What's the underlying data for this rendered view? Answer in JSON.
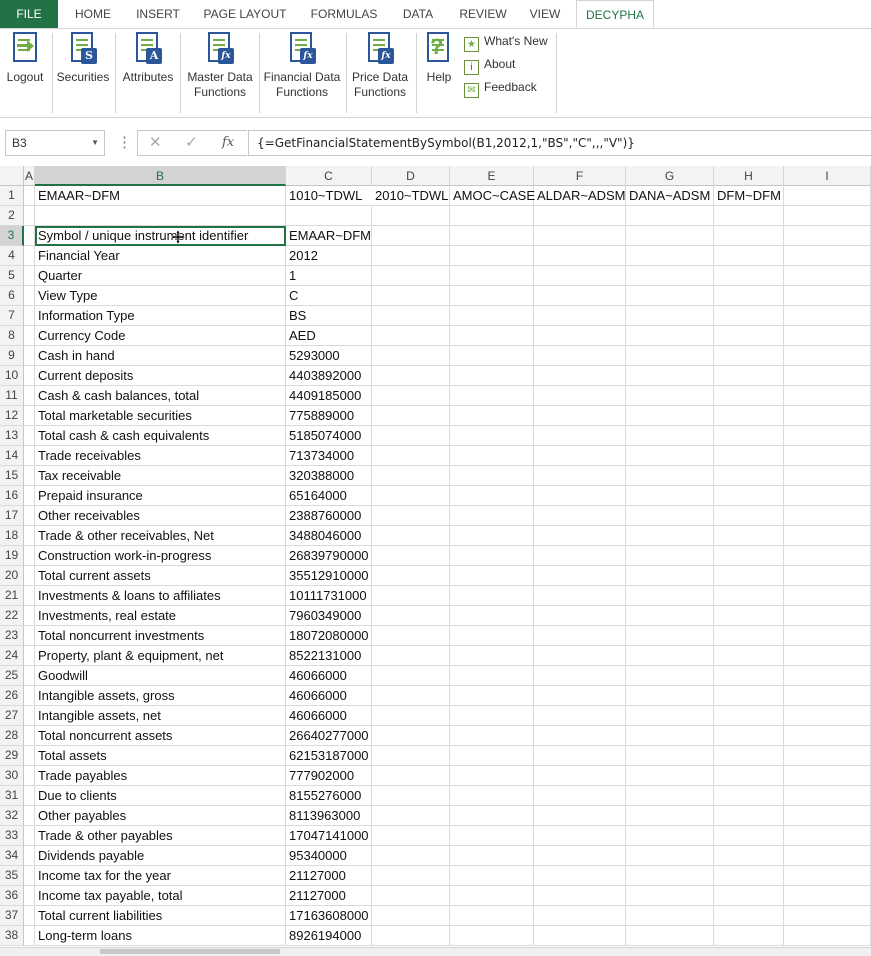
{
  "tabs": [
    "FILE",
    "HOME",
    "INSERT",
    "PAGE LAYOUT",
    "FORMULAS",
    "DATA",
    "REVIEW",
    "VIEW",
    "DECYPHA"
  ],
  "ribbon": {
    "logout": "Logout",
    "securities": "Securities",
    "attributes": "Attributes",
    "master_1": "Master Data",
    "master_2": "Functions",
    "financial_1": "Financial Data",
    "financial_2": "Functions",
    "price_1": "Price Data",
    "price_2": "Functions",
    "help": "Help",
    "whats_new": "What's New",
    "about": "About",
    "feedback": "Feedback"
  },
  "formula_bar": {
    "name_box": "B3",
    "formula": "{=GetFinancialStatementBySymbol(B1,2012,1,\"BS\",\"C\",,,\"V\")}",
    "fx": "fx"
  },
  "columns": [
    "A",
    "B",
    "C",
    "D",
    "E",
    "F",
    "G",
    "H",
    "I"
  ],
  "rows": [
    {
      "n": "1",
      "b": "EMAAR~DFM",
      "c": "1010~TDWL",
      "d": "2010~TDWL",
      "e": "AMOC~CASE",
      "f": "ALDAR~ADSM",
      "g": "DANA~ADSM",
      "h": "DFM~DFM"
    },
    {
      "n": "2",
      "b": "",
      "c": ""
    },
    {
      "n": "3",
      "b": "Symbol / unique instrument identifier",
      "c": "EMAAR~DFM"
    },
    {
      "n": "4",
      "b": "Financial Year",
      "c": "2012"
    },
    {
      "n": "5",
      "b": "Quarter",
      "c": "1"
    },
    {
      "n": "6",
      "b": "View Type",
      "c": "C"
    },
    {
      "n": "7",
      "b": "Information Type",
      "c": "BS"
    },
    {
      "n": "8",
      "b": "Currency Code",
      "c": "AED"
    },
    {
      "n": "9",
      "b": "Cash in hand",
      "c": "5293000"
    },
    {
      "n": "10",
      "b": "Current deposits",
      "c": "4403892000"
    },
    {
      "n": "11",
      "b": "Cash & cash balances, total",
      "c": "4409185000"
    },
    {
      "n": "12",
      "b": "Total marketable securities",
      "c": "775889000"
    },
    {
      "n": "13",
      "b": "Total cash & cash equivalents",
      "c": "5185074000"
    },
    {
      "n": "14",
      "b": "Trade receivables",
      "c": "713734000"
    },
    {
      "n": "15",
      "b": "Tax receivable",
      "c": "320388000"
    },
    {
      "n": "16",
      "b": "Prepaid insurance",
      "c": "65164000"
    },
    {
      "n": "17",
      "b": "Other receivables",
      "c": "2388760000"
    },
    {
      "n": "18",
      "b": "Trade & other receivables, Net",
      "c": "3488046000"
    },
    {
      "n": "19",
      "b": "Construction work-in-progress",
      "c": "26839790000"
    },
    {
      "n": "20",
      "b": "Total current assets",
      "c": "35512910000"
    },
    {
      "n": "21",
      "b": "Investments & loans to affiliates",
      "c": "10111731000"
    },
    {
      "n": "22",
      "b": "Investments, real estate",
      "c": "7960349000"
    },
    {
      "n": "23",
      "b": "Total noncurrent investments",
      "c": "18072080000"
    },
    {
      "n": "24",
      "b": "Property, plant & equipment, net",
      "c": "8522131000"
    },
    {
      "n": "25",
      "b": "Goodwill",
      "c": "46066000"
    },
    {
      "n": "26",
      "b": "Intangible assets, gross",
      "c": "46066000"
    },
    {
      "n": "27",
      "b": "Intangible assets, net",
      "c": "46066000"
    },
    {
      "n": "28",
      "b": "Total noncurrent assets",
      "c": "26640277000"
    },
    {
      "n": "29",
      "b": "Total assets",
      "c": "62153187000"
    },
    {
      "n": "30",
      "b": "Trade payables",
      "c": "777902000"
    },
    {
      "n": "31",
      "b": "Due to clients",
      "c": "8155276000"
    },
    {
      "n": "32",
      "b": "Other payables",
      "c": "8113963000"
    },
    {
      "n": "33",
      "b": "Trade & other payables",
      "c": "17047141000"
    },
    {
      "n": "34",
      "b": "Dividends payable",
      "c": "95340000"
    },
    {
      "n": "35",
      "b": "Income tax for the year",
      "c": "21127000"
    },
    {
      "n": "36",
      "b": "Income tax payable, total",
      "c": "21127000"
    },
    {
      "n": "37",
      "b": "Total current liabilities",
      "c": "17163608000"
    },
    {
      "n": "38",
      "b": "Long-term loans",
      "c": "8926194000"
    }
  ]
}
